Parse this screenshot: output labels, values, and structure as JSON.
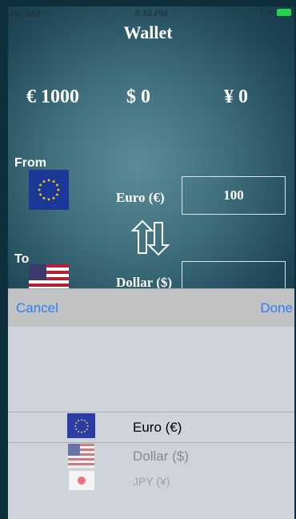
{
  "status_bar": {
    "carrier": "No SIM",
    "time": "8:33 PM"
  },
  "app": {
    "title": "Wallet"
  },
  "balances": [
    {
      "label": "€ 1000"
    },
    {
      "label": "$ 0"
    },
    {
      "label": "¥ 0"
    }
  ],
  "converter": {
    "from_label": "From",
    "to_label": "To",
    "from_currency": "Euro (€)",
    "to_currency": "Dollar ($)",
    "from_amount": "100",
    "to_amount": ""
  },
  "picker_toolbar": {
    "cancel_label": "Cancel",
    "done_label": "Done"
  },
  "picker": {
    "options": [
      {
        "label": "Euro (€)",
        "icon": "eu-flag-icon",
        "selected": true
      },
      {
        "label": "Dollar ($)",
        "icon": "us-flag-icon",
        "selected": false
      },
      {
        "label": "JPY (¥)",
        "icon": "jp-flag-icon",
        "selected": false
      }
    ]
  },
  "colors": {
    "accent": "#2f7cf6",
    "battery": "#25d24a",
    "eu_blue": "#1b3797"
  }
}
